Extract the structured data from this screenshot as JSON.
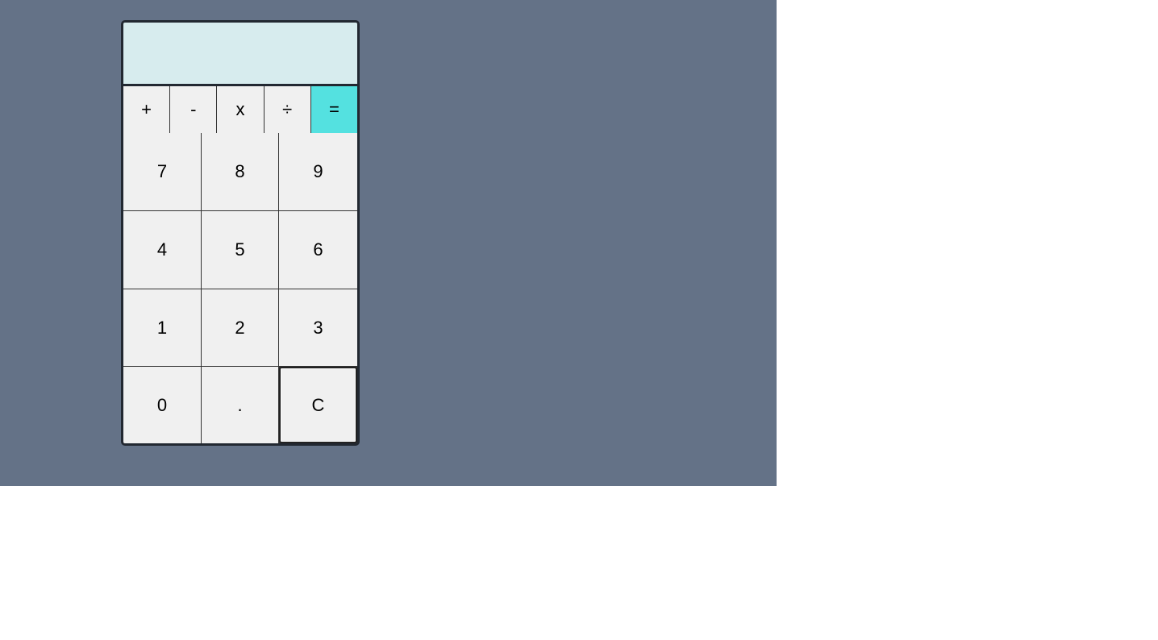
{
  "calculator": {
    "display_value": "",
    "operators": [
      "+",
      "-",
      "x",
      "÷",
      "="
    ],
    "digits": [
      "7",
      "8",
      "9",
      "4",
      "5",
      "6",
      "1",
      "2",
      "3",
      "0",
      ".",
      "C"
    ]
  },
  "colors": {
    "background": "#647287",
    "display": "#d7ecee",
    "equals": "#54e1e0",
    "key": "#f0f0f0",
    "frame": "#222831"
  }
}
